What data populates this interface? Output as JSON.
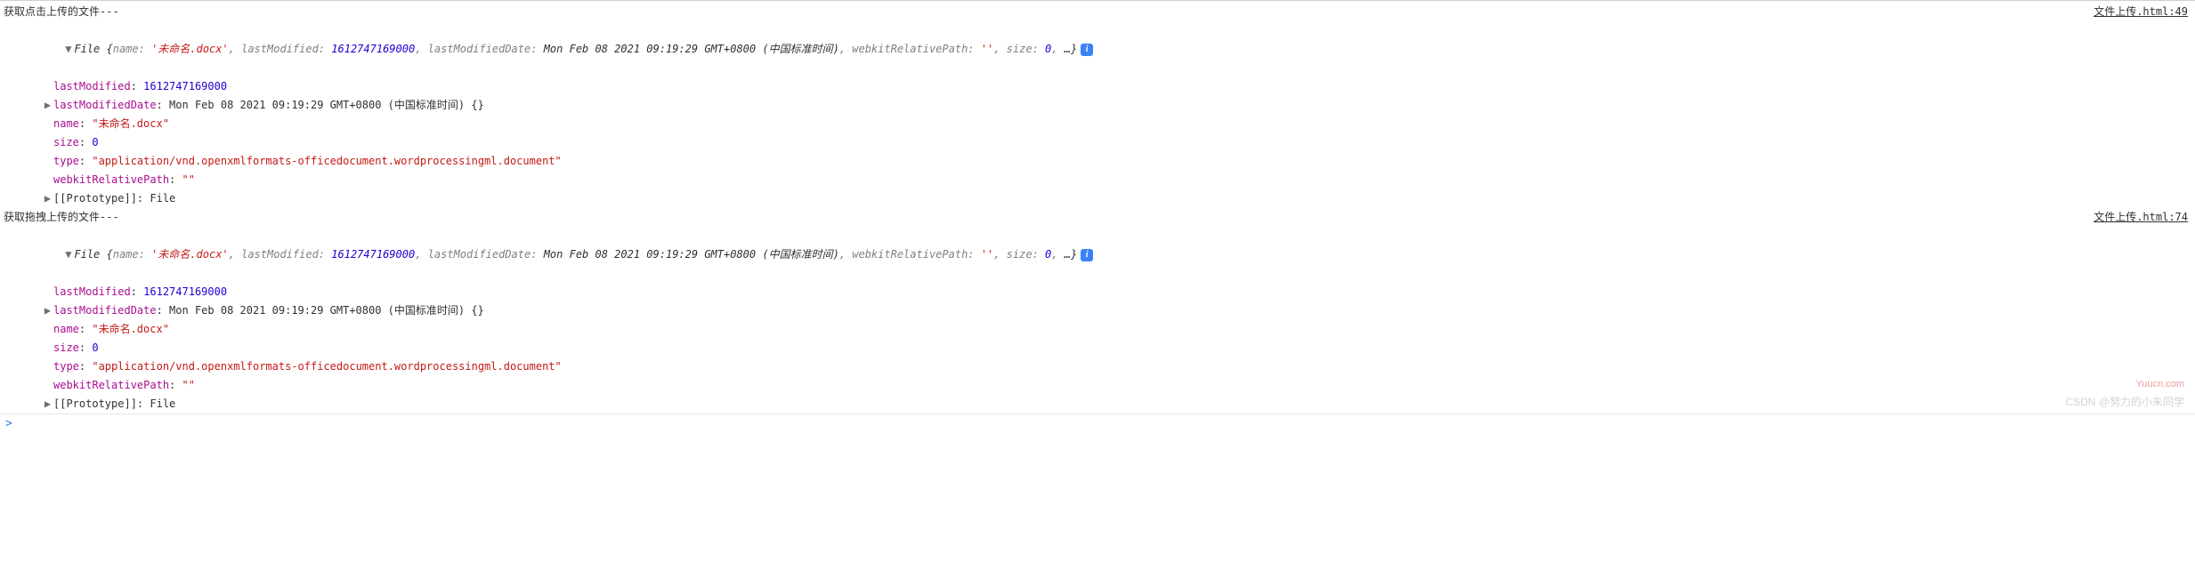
{
  "blocks": [
    {
      "header_text": "获取点击上传的文件---",
      "source_file": "文件上传.html",
      "source_line": "49",
      "summary": {
        "class": "File",
        "name_key": "name:",
        "name_val": "'未命名.docx'",
        "lm_key": "lastModified:",
        "lm_val": "1612747169000",
        "lmd_key": "lastModifiedDate:",
        "lmd_val": "Mon Feb 08 2021 09:19:29 GMT+0800 (中国标准时间)",
        "wrp_key": "webkitRelativePath:",
        "wrp_val": "''",
        "size_key": "size:",
        "size_val": "0",
        "trail": "…}"
      },
      "props": {
        "lastModified_k": "lastModified",
        "lastModified_v": "1612747169000",
        "lastModifiedDate_k": "lastModifiedDate",
        "lastModifiedDate_v": "Mon Feb 08 2021 09:19:29 GMT+0800 (中国标准时间)",
        "lastModifiedDate_suffix": "{}",
        "name_k": "name",
        "name_v": "\"未命名.docx\"",
        "size_k": "size",
        "size_v": "0",
        "type_k": "type",
        "type_v": "\"application/vnd.openxmlformats-officedocument.wordprocessingml.document\"",
        "wrp_k": "webkitRelativePath",
        "wrp_v": "\"\"",
        "proto_k": "[[Prototype]]",
        "proto_v": "File"
      }
    },
    {
      "header_text": "获取拖拽上传的文件---",
      "source_file": "文件上传.html",
      "source_line": "74",
      "summary": {
        "class": "File",
        "name_key": "name:",
        "name_val": "'未命名.docx'",
        "lm_key": "lastModified:",
        "lm_val": "1612747169000",
        "lmd_key": "lastModifiedDate:",
        "lmd_val": "Mon Feb 08 2021 09:19:29 GMT+0800 (中国标准时间)",
        "wrp_key": "webkitRelativePath:",
        "wrp_val": "''",
        "size_key": "size:",
        "size_val": "0",
        "trail": "…}"
      },
      "props": {
        "lastModified_k": "lastModified",
        "lastModified_v": "1612747169000",
        "lastModifiedDate_k": "lastModifiedDate",
        "lastModifiedDate_v": "Mon Feb 08 2021 09:19:29 GMT+0800 (中国标准时间)",
        "lastModifiedDate_suffix": "{}",
        "name_k": "name",
        "name_v": "\"未命名.docx\"",
        "size_k": "size",
        "size_v": "0",
        "type_k": "type",
        "type_v": "\"application/vnd.openxmlformats-officedocument.wordprocessingml.document\"",
        "wrp_k": "webkitRelativePath",
        "wrp_v": "\"\"",
        "proto_k": "[[Prototype]]",
        "proto_v": "File"
      }
    }
  ],
  "info_badge": "i",
  "triangles": {
    "right": "▶",
    "down": "▼"
  },
  "comma": ", ",
  "colon": ": ",
  "brace_open": " {",
  "watermarks": {
    "yuucn": "Yuucn.com",
    "csdn": "CSDN @努力的小朱同学"
  },
  "prompt": ">"
}
